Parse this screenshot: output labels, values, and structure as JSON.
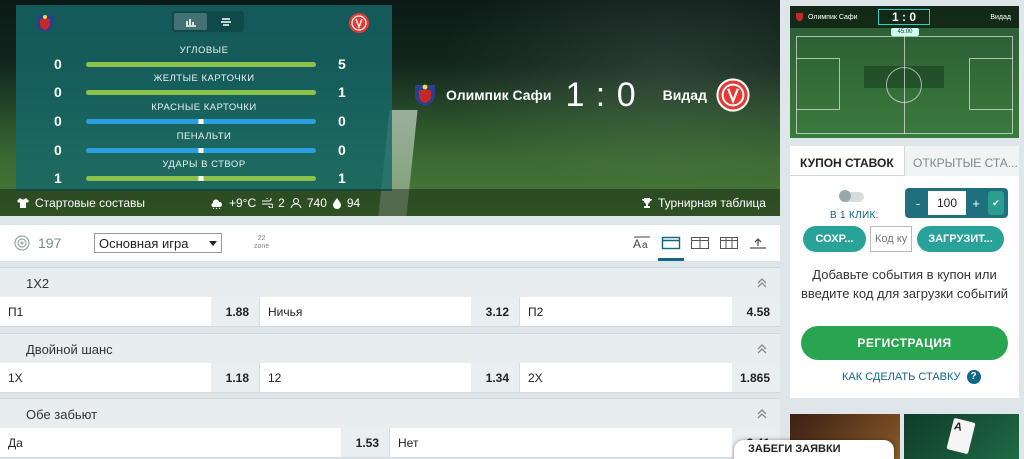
{
  "match": {
    "home": "Олимпик Сафи",
    "away": "Видад",
    "score": "1 : 0"
  },
  "stats": [
    {
      "label": "УГЛОВЫЕ",
      "home": "0",
      "away": "5",
      "bar": "green"
    },
    {
      "label": "ЖЕЛТЫЕ КАРТОЧКИ",
      "home": "0",
      "away": "1",
      "bar": "green"
    },
    {
      "label": "КРАСНЫЕ КАРТОЧКИ",
      "home": "0",
      "away": "0",
      "bar": "blue"
    },
    {
      "label": "ПЕНАЛЬТИ",
      "home": "0",
      "away": "0",
      "bar": "blue"
    },
    {
      "label": "УДАРЫ В СТВОР",
      "home": "1",
      "away": "1",
      "bar": "split-green"
    }
  ],
  "info": {
    "lineups": "Стартовые составы",
    "temp": "+9°C",
    "wind": "2",
    "attendance": "740",
    "humidity": "94",
    "standings": "Турнирная таблица"
  },
  "toolbar": {
    "count": "197",
    "select": "Основная игра",
    "zone_top": "22",
    "zone_bottom": "zone"
  },
  "markets": [
    {
      "title": "1X2",
      "odds": [
        {
          "name": "П1",
          "value": "1.88"
        },
        {
          "name": "Ничья",
          "value": "3.12"
        },
        {
          "name": "П2",
          "value": "4.58"
        }
      ]
    },
    {
      "title": "Двойной шанс",
      "odds": [
        {
          "name": "1X",
          "value": "1.18"
        },
        {
          "name": "12",
          "value": "1.34"
        },
        {
          "name": "2X",
          "value": "1.865"
        }
      ]
    },
    {
      "title": "Обе забьют",
      "odds": [
        {
          "name": "Да",
          "value": "1.53"
        },
        {
          "name": "Нет",
          "value": "2.41"
        }
      ]
    }
  ],
  "mini": {
    "home": "Олимпик Сафи",
    "away": "Видад",
    "score": "1 : 0",
    "time": "45:00"
  },
  "coupon": {
    "tab_active": "КУПОН СТАВОК",
    "tab_other": "ОТКРЫТЫЕ СТА...",
    "one_click": "В 1 КЛИК:",
    "stake": "100",
    "minus": "-",
    "plus": "+",
    "save": "СОХР...",
    "code_placeholder": "Код ку",
    "load": "ЗАГРУЗИТ...",
    "message": "Добавьте события в купон или введите код для загрузки событий",
    "register": "РЕГИСТРАЦИЯ",
    "how_to": "КАК СДЕЛАТЬ СТАВКУ"
  },
  "promo": {
    "card": "A"
  },
  "popup": "ЗАБЕГИ ЗАЯВКИ"
}
